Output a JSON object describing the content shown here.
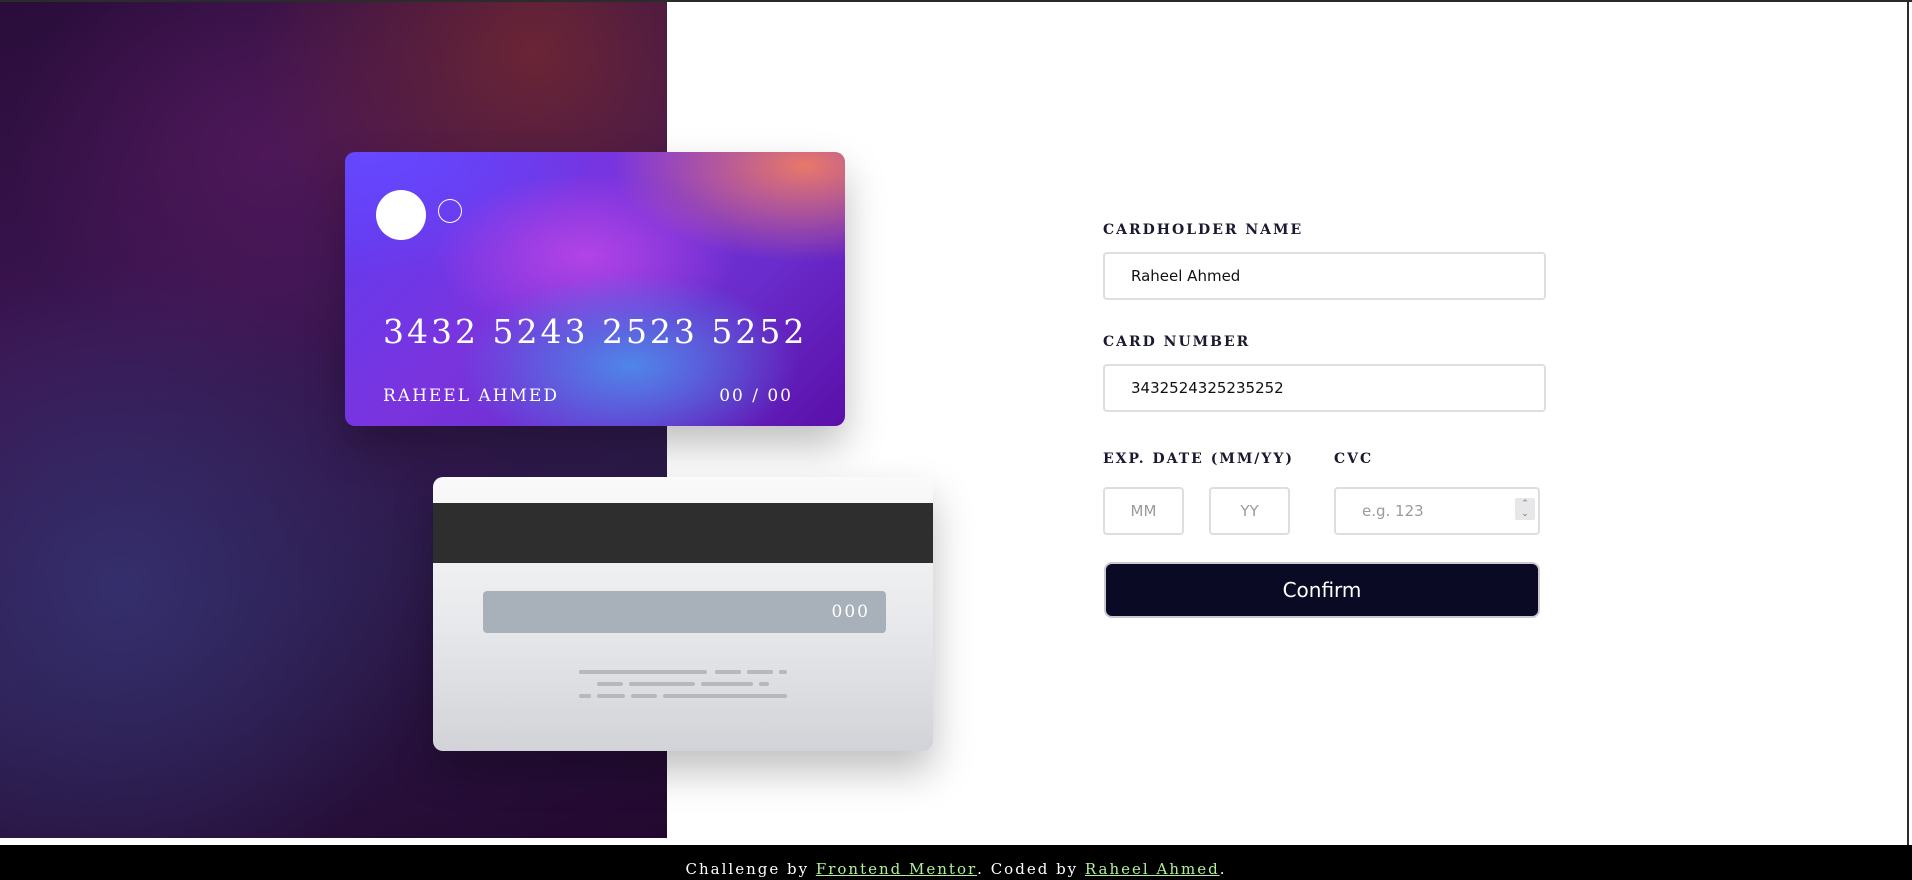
{
  "card": {
    "number": "3432 5243 2523 5252",
    "name": "Raheel Ahmed",
    "expiry": "00 / 00",
    "cvc": "000"
  },
  "form": {
    "cardholder_label": "Cardholder Name",
    "cardholder_value": "Raheel Ahmed",
    "card_number_label": "Card Number",
    "card_number_value": "3432524325235252",
    "exp_date_label": "Exp. Date (MM/YY)",
    "month_placeholder": "MM",
    "year_placeholder": "YY",
    "cvc_label": "CVC",
    "cvc_placeholder": "e.g. 123",
    "confirm_label": "Confirm"
  },
  "footer": {
    "prefix": "Challenge by ",
    "mentor_link": "Frontend Mentor",
    "middle": ". Coded by ",
    "author_link": "Raheel Ahmed",
    "suffix": "."
  },
  "colors": {
    "button_bg": "#0b0a24",
    "footer_link": "#aef098",
    "card_gradient_start": "#6648ff",
    "card_gradient_end": "#5a0fa8"
  },
  "icons": {
    "stepper": "up-down-chevron-icon"
  }
}
